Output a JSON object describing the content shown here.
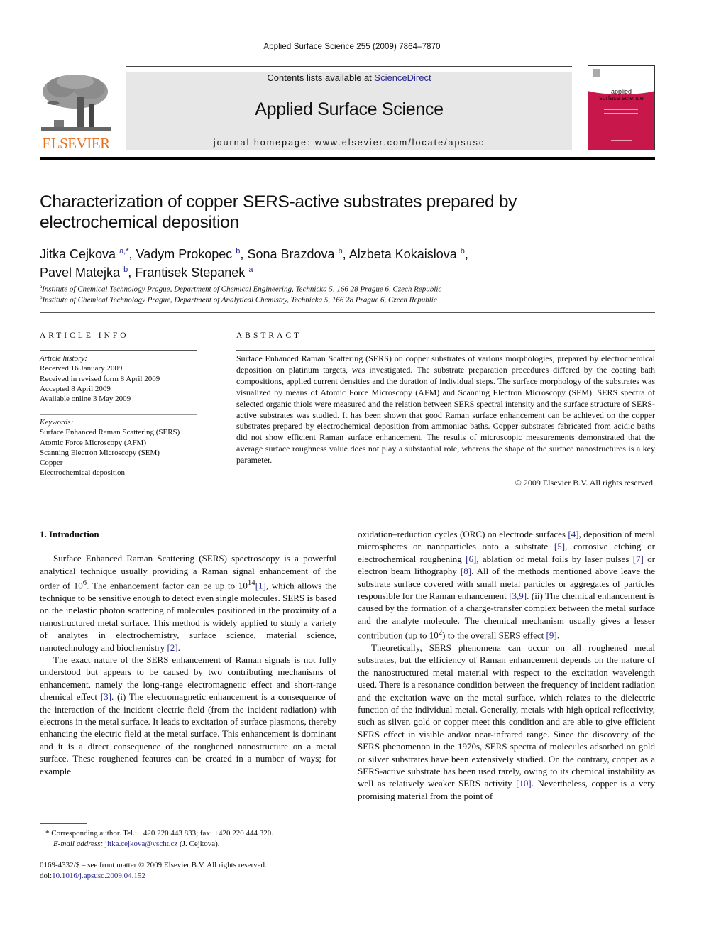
{
  "journal": {
    "running_head": "Applied Surface Science 255 (2009) 7864–7870",
    "contents_prefix": "Contents lists available at ",
    "contents_link": "ScienceDirect",
    "name": "Applied Surface Science",
    "homepage": "journal homepage: www.elsevier.com/locate/apsusc",
    "publisher_logo": "ELSEVIER",
    "cover_title_line1": "applied",
    "cover_title_line2": "surface science",
    "accent_color": "#e9711c",
    "cover_color": "#c8174a",
    "link_color": "#2a2a8c"
  },
  "article": {
    "title_line1": "Characterization of copper SERS-active substrates prepared by",
    "title_line2": "electrochemical deposition",
    "authors": [
      {
        "name": "Jitka Cejkova",
        "sup": "a,*",
        "sep": ", "
      },
      {
        "name": "Vadym Prokopec",
        "sup": "b",
        "sep": ", "
      },
      {
        "name": "Sona Brazdova",
        "sup": "b",
        "sep": ", "
      },
      {
        "name": "Alzbeta Kokaislova",
        "sup": "b",
        "sep": ","
      },
      {
        "name": "Pavel Matejka",
        "sup": "b",
        "sep": ", "
      },
      {
        "name": "Frantisek Stepanek",
        "sup": "a",
        "sep": ""
      }
    ],
    "affiliations": [
      {
        "sup": "a",
        "text": "Institute of Chemical Technology Prague, Department of Chemical Engineering, Technicka 5, 166 28 Prague 6, Czech Republic"
      },
      {
        "sup": "b",
        "text": "Institute of Chemical Technology Prague, Department of Analytical Chemistry, Technicka 5, 166 28 Prague 6, Czech Republic"
      }
    ]
  },
  "article_info": {
    "heading": "ARTICLE INFO",
    "history_label": "Article history:",
    "history": [
      "Received 16 January 2009",
      "Received in revised form 8 April 2009",
      "Accepted 8 April 2009",
      "Available online 3 May 2009"
    ],
    "keywords_label": "Keywords:",
    "keywords": [
      "Surface Enhanced Raman Scattering (SERS)",
      "Atomic Force Microscopy (AFM)",
      "Scanning Electron Microscopy (SEM)",
      "Copper",
      "Electrochemical deposition"
    ]
  },
  "abstract": {
    "heading": "ABSTRACT",
    "text": "Surface Enhanced Raman Scattering (SERS) on copper substrates of various morphologies, prepared by electrochemical deposition on platinum targets, was investigated. The substrate preparation procedures differed by the coating bath compositions, applied current densities and the duration of individual steps. The surface morphology of the substrates was visualized by means of Atomic Force Microscopy (AFM) and Scanning Electron Microscopy (SEM). SERS spectra of selected organic thiols were measured and the relation between SERS spectral intensity and the surface structure of SERS-active substrates was studied. It has been shown that good Raman surface enhancement can be achieved on the copper substrates prepared by electrochemical deposition from ammoniac baths. Copper substrates fabricated from acidic baths did not show efficient Raman surface enhancement. The results of microscopic measurements demonstrated that the average surface roughness value does not play a substantial role, whereas the shape of the surface nanostructures is a key parameter.",
    "copyright": "© 2009 Elsevier B.V. All rights reserved."
  },
  "body": {
    "section_heading": "1.  Introduction",
    "p1": {
      "a": "Surface Enhanced Raman Scattering (SERS) spectroscopy is a powerful analytical technique usually providing a Raman signal enhancement of the order of 10",
      "a_sup": "6",
      "b": ". The enhancement factor can be up to 10",
      "b_sup": "14",
      "ref1": "[1]",
      "c": ", which allows the technique to be sensitive enough to detect even single molecules. SERS is based on the inelastic photon scattering of molecules positioned in the proximity of a nanostructured metal surface. This method is widely applied to study a variety of analytes in electrochemistry, surface science, material science, nanotechnology and biochemistry ",
      "ref2": "[2]",
      "d": "."
    },
    "p2": {
      "a": "The exact nature of the SERS enhancement of Raman signals is not fully understood but appears to be caused by two contributing mechanisms of enhancement, namely the long-range electromagnetic effect and short-range chemical effect ",
      "ref3": "[3]",
      "b": ". (i) The electromagnetic enhancement is a consequence of the interaction of the incident electric field (from the incident radiation) with electrons in the metal surface. It leads to excitation of surface plasmons, thereby enhancing the electric field at the metal surface. This enhancement is dominant and it is a direct consequence of the roughened nanostructure on a metal surface. These roughened features can be created in a number of ways; for example"
    },
    "p3": {
      "a": "oxidation–reduction cycles (ORC) on electrode surfaces ",
      "ref4": "[4]",
      "b": ", deposition of metal microspheres or nanoparticles onto a substrate ",
      "ref5": "[5]",
      "c": ", corrosive etching or electrochemical roughening ",
      "ref6": "[6]",
      "d": ", ablation of metal foils by laser pulses ",
      "ref7": "[7]",
      "e": " or electron beam lithography ",
      "ref8": "[8]",
      "f": ". All of the methods mentioned above leave the substrate surface covered with small metal particles or aggregates of particles responsible for the Raman enhancement ",
      "ref39": "[3,9]",
      "g": ". (ii) The chemical enhancement is caused by the formation of a charge-transfer complex between the metal surface and the analyte molecule. The chemical mechanism usually gives a lesser contribution (up to 10",
      "g_sup": "2",
      "h": ") to the overall SERS effect ",
      "ref9": "[9]",
      "i": "."
    },
    "p4": {
      "a": "Theoretically, SERS phenomena can occur on all roughened metal substrates, but the efficiency of Raman enhancement depends on the nature of the nanostructured metal material with respect to the excitation wavelength used. There is a resonance condition between the frequency of incident radiation and the excitation wave on the metal surface, which relates to the dielectric function of the individual metal. Generally, metals with high optical reflectivity, such as silver, gold or copper meet this condition and are able to give efficient SERS effect in visible and/or near-infrared range. Since the discovery of the SERS phenomenon in the 1970s, SERS spectra of molecules adsorbed on gold or silver substrates have been extensively studied. On the contrary, copper as a SERS-active substrate has been used rarely, owing to its chemical instability as well as relatively weaker SERS activity ",
      "ref10": "[10]",
      "b": ". Nevertheless, copper is a very promising material from the point of"
    }
  },
  "footnotes": {
    "corresponding": "* Corresponding author. Tel.: +420 220 443 833; fax: +420 220 444 320.",
    "email_label": "E-mail address: ",
    "email": "jitka.cejkova@vscht.cz",
    "email_suffix": " (J. Cejkova).",
    "issn_line": "0169-4332/$ – see front matter © 2009 Elsevier B.V. All rights reserved.",
    "doi_prefix": "doi:",
    "doi": "10.1016/j.apsusc.2009.04.152"
  }
}
